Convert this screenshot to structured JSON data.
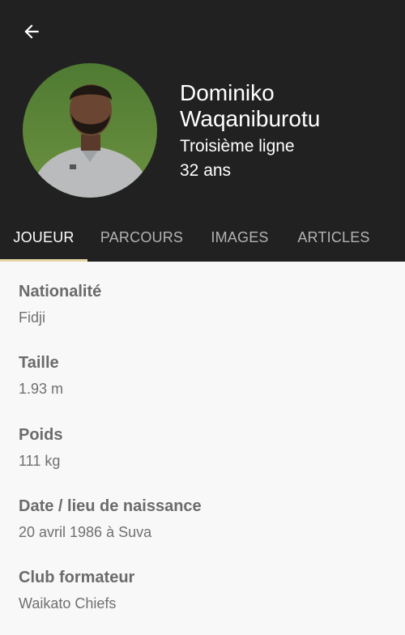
{
  "player": {
    "name": "Dominiko Waqaniburotu",
    "position": "Troisième ligne",
    "age": "32 ans"
  },
  "tabs": [
    {
      "label": "JOUEUR",
      "active": true
    },
    {
      "label": "PARCOURS",
      "active": false
    },
    {
      "label": "IMAGES",
      "active": false
    },
    {
      "label": "ARTICLES",
      "active": false
    }
  ],
  "fields": [
    {
      "label": "Nationalité",
      "value": "Fidji"
    },
    {
      "label": "Taille",
      "value": "1.93 m"
    },
    {
      "label": "Poids",
      "value": "111 kg"
    },
    {
      "label": "Date / lieu de naissance",
      "value": "20 avril 1986 à Suva"
    },
    {
      "label": "Club formateur",
      "value": "Waikato Chiefs"
    }
  ],
  "colors": {
    "header_bg": "#212121",
    "tab_indicator": "#e8d7a5",
    "content_bg": "#f8f8f8"
  },
  "icons": {
    "back": "arrow-left-icon"
  }
}
